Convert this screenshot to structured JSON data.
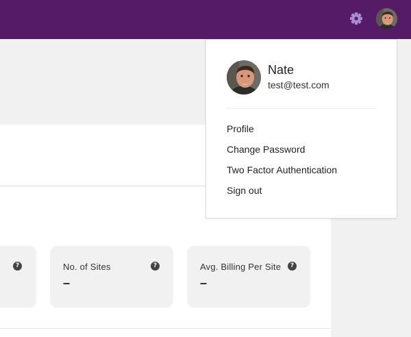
{
  "header": {
    "settings_icon": "gear-icon",
    "avatar_icon": "user-avatar",
    "color": "#561b67"
  },
  "account_menu": {
    "name": "Nate",
    "email": "test@test.com",
    "items": [
      "Profile",
      "Change Password",
      "Two Factor Authentication",
      "Sign out"
    ]
  },
  "stats": {
    "cards": [
      {
        "label": "",
        "value": ""
      },
      {
        "label": "No. of Sites",
        "value": "–"
      },
      {
        "label": "Avg. Billing Per Site",
        "value": "–"
      }
    ],
    "help_glyph": "?"
  }
}
